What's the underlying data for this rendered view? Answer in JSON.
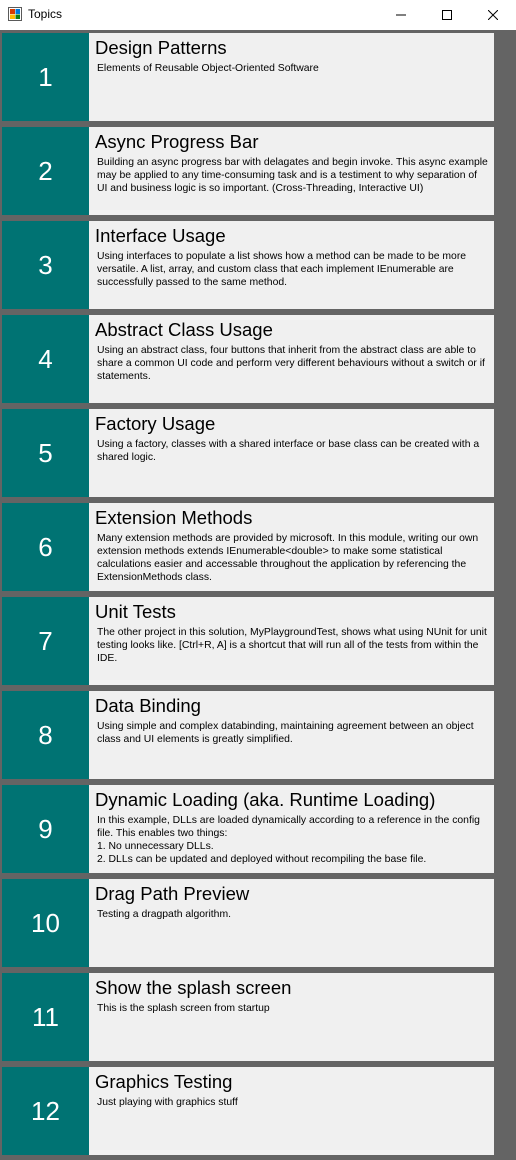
{
  "window": {
    "title": "Topics",
    "icon": "app-icon",
    "controls": [
      "minimize-icon",
      "maximize-icon",
      "close-icon"
    ]
  },
  "colors": {
    "client_background": "#646464",
    "number_panel": "#007373",
    "card_background": "#f0f0f0"
  },
  "topics": [
    {
      "number": "1",
      "title": "Design Patterns",
      "description": "Elements of Reusable Object-Oriented Software"
    },
    {
      "number": "2",
      "title": "Async Progress Bar",
      "description": "Building an async progress bar with delagates and begin invoke. This async example may be applied to any time-consuming task and is a testiment to why separation of UI and business logic is so important. (Cross-Threading, Interactive UI)"
    },
    {
      "number": "3",
      "title": "Interface Usage",
      "description": "Using interfaces to populate a list shows how a method can be made to be more versatile. A list, array, and custom class that each implement IEnumerable are successfully passed to the same method."
    },
    {
      "number": "4",
      "title": "Abstract Class Usage",
      "description": "Using an abstract class, four buttons that inherit from the abstract class are able to share a common UI code and perform very different behaviours without a switch or if statements."
    },
    {
      "number": "5",
      "title": "Factory Usage",
      "description": "Using a factory, classes with a shared interface or base class can be created with a shared logic."
    },
    {
      "number": "6",
      "title": "Extension Methods",
      "description": "Many extension methods are provided by microsoft. In this module, writing our own extension methods extends IEnumerable<double> to make some statistical calculations easier and accessable throughout the application by referencing the ExtensionMethods class."
    },
    {
      "number": "7",
      "title": "Unit Tests",
      "description": "The other project in this solution, MyPlaygroundTest, shows what using NUnit for unit testing looks like. [Ctrl+R, A] is a shortcut that will run all of the tests from within the IDE."
    },
    {
      "number": "8",
      "title": "Data Binding",
      "description": "Using simple and complex databinding, maintaining agreement between an object class and UI elements is greatly simplified."
    },
    {
      "number": "9",
      "title": "Dynamic Loading (aka. Runtime Loading)",
      "description": "In this example, DLLs are loaded dynamically according to a reference in the config file. This enables two things:\n1. No unnecessary DLLs.\n2. DLLs can be updated and deployed without recompiling the base file."
    },
    {
      "number": "10",
      "title": "Drag Path Preview",
      "description": "Testing a dragpath algorithm."
    },
    {
      "number": "11",
      "title": "Show the splash screen",
      "description": "This is the splash screen from startup"
    },
    {
      "number": "12",
      "title": "Graphics Testing",
      "description": "Just playing with graphics stuff"
    }
  ]
}
